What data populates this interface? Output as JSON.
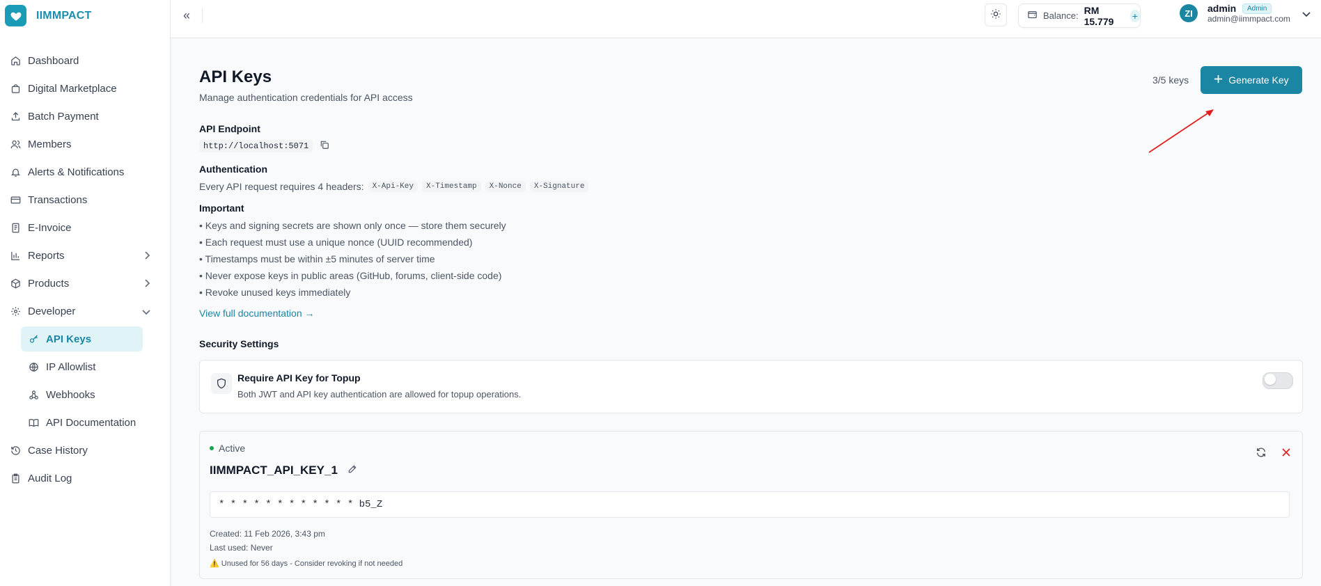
{
  "brand": {
    "name": "IIMMPACT"
  },
  "sidebar": {
    "items": [
      {
        "label": "Dashboard",
        "icon": "home-icon"
      },
      {
        "label": "Digital Marketplace",
        "icon": "bag-icon"
      },
      {
        "label": "Batch Payment",
        "icon": "upload-icon"
      },
      {
        "label": "Members",
        "icon": "users-icon"
      },
      {
        "label": "Alerts & Notifications",
        "icon": "bell-icon"
      },
      {
        "label": "Transactions",
        "icon": "card-icon"
      },
      {
        "label": "E-Invoice",
        "icon": "invoice-icon"
      },
      {
        "label": "Reports",
        "icon": "bar-chart-icon"
      },
      {
        "label": "Products",
        "icon": "box-icon"
      },
      {
        "label": "Developer",
        "icon": "gear-icon"
      }
    ],
    "developer_sub": [
      {
        "label": "API Keys",
        "icon": "key-icon"
      },
      {
        "label": "IP Allowlist",
        "icon": "globe-icon"
      },
      {
        "label": "Webhooks",
        "icon": "webhook-icon"
      },
      {
        "label": "API Documentation",
        "icon": "book-icon"
      }
    ],
    "bottom": [
      {
        "label": "Case History",
        "icon": "history-icon"
      },
      {
        "label": "Audit Log",
        "icon": "clipboard-icon"
      }
    ]
  },
  "topbar": {
    "collapse": "«",
    "balance_label": "Balance:",
    "balance_value": "RM 15.779",
    "balance_plus": "+",
    "avatar_initials": "ZI",
    "user_name": "admin",
    "user_role": "Admin",
    "user_email": "admin@iimmpact.com"
  },
  "page": {
    "title": "API Keys",
    "subtitle": "Manage authentication credentials for API access",
    "key_count": "3/5 keys",
    "generate_label": "Generate Key",
    "endpoint_label": "API Endpoint",
    "endpoint_value": "http://localhost:5071",
    "auth_label": "Authentication",
    "auth_text": "Every API request requires 4 headers:",
    "headers": [
      "X-Api-Key",
      "X-Timestamp",
      "X-Nonce",
      "X-Signature"
    ],
    "important_label": "Important",
    "important_items": [
      "• Keys and signing secrets are shown only once — store them securely",
      "• Each request must use a unique nonce (UUID recommended)",
      "• Timestamps must be within ±5 minutes of server time",
      "• Never expose keys in public areas (GitHub, forums, client-side code)",
      "• Revoke unused keys immediately"
    ],
    "docs_link": "View full documentation →",
    "security_label": "Security Settings",
    "security": {
      "title": "Require API Key for Topup",
      "description": "Both JWT and API key authentication are allowed for topup operations.",
      "enabled": false
    },
    "key": {
      "status": "Active",
      "name": "IIMMPACT_API_KEY_1",
      "masked": "* * * * * * * * * * * * b5_Z",
      "created": "Created: 11 Feb 2026, 3:43 pm",
      "last_used": "Last used: Never",
      "warning": "⚠️ Unused for 56 days - Consider revoking if not needed"
    }
  },
  "colors": {
    "accent": "#1a86a3",
    "active_dot": "#16a34a",
    "danger": "#dc2626",
    "annotation_arrow": "#e11d1d"
  }
}
